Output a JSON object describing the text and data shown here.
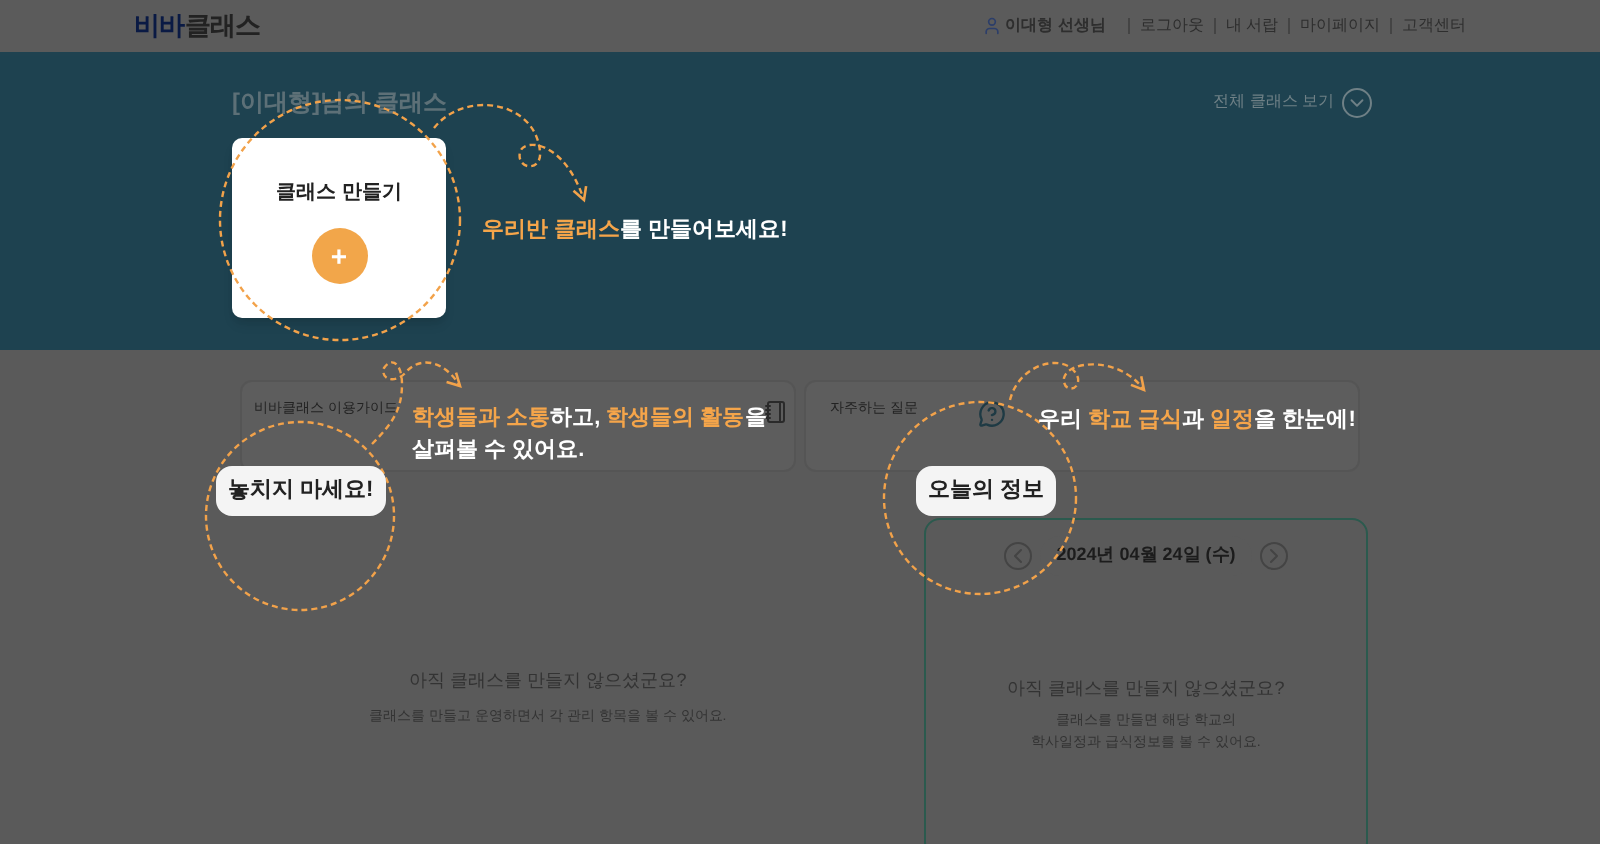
{
  "header": {
    "logo": {
      "part_1": "비바",
      "part_2": "클래스"
    },
    "user": "이대형 선생님",
    "links": [
      "로그아웃",
      "내 서랍",
      "마이페이지",
      "고객센터"
    ]
  },
  "banner": {
    "title": "[이대형]님의 클래스",
    "view_all": "전체 클래스 보기",
    "create_card": {
      "label": "클래스 만들기",
      "button": "+"
    }
  },
  "shortcuts": [
    {
      "label": "비바클래스 이용가이드",
      "kind": "guide"
    },
    {
      "label": "자주하는 질문",
      "kind": "faq"
    }
  ],
  "class_panel": {
    "heading": "아직 클래스를 만들지 않으셨군요?",
    "text": "클래스를 만들고 운영하면서 각 관리 항목을 볼 수 있어요."
  },
  "today_panel": {
    "date": "2024년 04월 24일 (수)",
    "heading": "아직 클래스를 만들지 않으셨군요?",
    "lines": [
      "클래스를 만들면 해당 학교의",
      "학사일정과 급식정보를 볼 수 있어요."
    ]
  },
  "tour": {
    "steps": [
      {
        "lines": [
          [
            {
              "text": "우리반 클래스",
              "highlight": true
            },
            {
              "text": "를 만들어보세요!",
              "highlight": false
            }
          ]
        ]
      },
      {
        "badge": "놓치지 마세요!",
        "lines": [
          [
            {
              "text": "학생들과 소통",
              "highlight": true
            },
            {
              "text": "하고, ",
              "highlight": false
            },
            {
              "text": "학생들의 활동",
              "highlight": true
            },
            {
              "text": "을",
              "highlight": false
            }
          ],
          [
            {
              "text": "살펴볼 수 있어요.",
              "highlight": false
            }
          ]
        ]
      },
      {
        "badge": "오늘의 정보",
        "lines": [
          [
            {
              "text": "우리 ",
              "highlight": false
            },
            {
              "text": "학교 급식",
              "highlight": true
            },
            {
              "text": "과 ",
              "highlight": false
            },
            {
              "text": "일정",
              "highlight": true
            },
            {
              "text": "을 한눈에!",
              "highlight": false
            }
          ]
        ]
      }
    ]
  }
}
